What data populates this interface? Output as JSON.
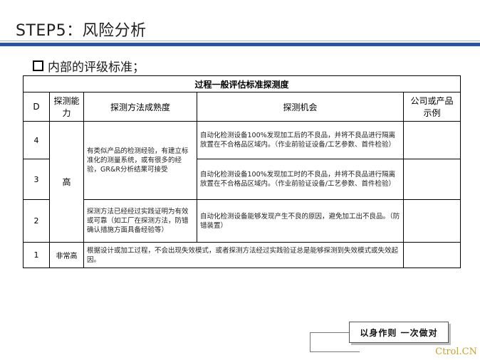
{
  "title": "STEP5：风险分析",
  "subhead": "内部的评级标准；",
  "table": {
    "caption": "过程一般评估标准探测度",
    "headers": {
      "d": "D",
      "ability": "探测能力",
      "method": "探测方法成熟度",
      "opportunity": "探测机会",
      "example": "公司或产品示例"
    },
    "rows": {
      "r4": {
        "d": "4",
        "method": "有类似产品的检测经验，有建立标准化的测量系统，或有很多的经验，GR&R分析结果可接受",
        "opportunity": "自动化检测设备100%发现加工后的不良品，并将不良品进行隔离放置在不合格品区域内。（作业前验证设备/工艺参数、首件检验）"
      },
      "r3": {
        "d": "3",
        "ability": "高",
        "opportunity": "自动化检测设备100%发现加工时的不良品，并将不良品进行隔离放置在不合格品区域内。（作业前验证设备/工艺参数、首件检验）"
      },
      "r2": {
        "d": "2",
        "method": "探测方法已经经过实践证明为有效或可靠（如工厂在探测方法，防错确认措施方面具备经验等）",
        "opportunity": "自动化检测设备能够发现产生不良的原因，避免加工出不良品。（防错装置）"
      },
      "r1": {
        "d": "1",
        "ability": "非常高",
        "merged": "根据设计或加工过程，不会出现失效模式，或者探测方法经过实践验证总是能够探测到失效模式或失效起因。"
      }
    }
  },
  "tag": "以身作则  一次做对",
  "footer": "Ctrol.CN"
}
